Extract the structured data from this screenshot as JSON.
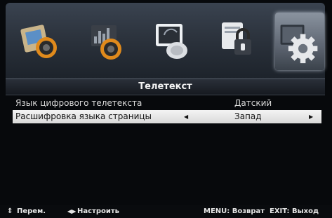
{
  "icon_bar": {
    "icons": [
      {
        "name": "picture-settings-icon"
      },
      {
        "name": "sound-settings-icon"
      },
      {
        "name": "channel-settings-icon"
      },
      {
        "name": "lock-settings-icon"
      },
      {
        "name": "setup-gear-icon",
        "active": true
      }
    ]
  },
  "menu": {
    "title": "Телетекст",
    "rows": [
      {
        "label": "Язык цифрового телетекста",
        "value": "Датский",
        "selected": false
      },
      {
        "label": "Расшифровка языка страницы",
        "value": "Запад",
        "selected": true,
        "left_arrow": "◀",
        "right_arrow": "▶"
      }
    ]
  },
  "hints": {
    "updown_glyph": "⇕",
    "move": "Перем.",
    "leftright_glyph": "◀▶",
    "adjust": "Настроить",
    "menu": "MENU: Возврат",
    "exit": "EXIT: Выход"
  },
  "colors": {
    "selected_row": "#e6e6e6",
    "accent_orange": "#f08a1a"
  }
}
